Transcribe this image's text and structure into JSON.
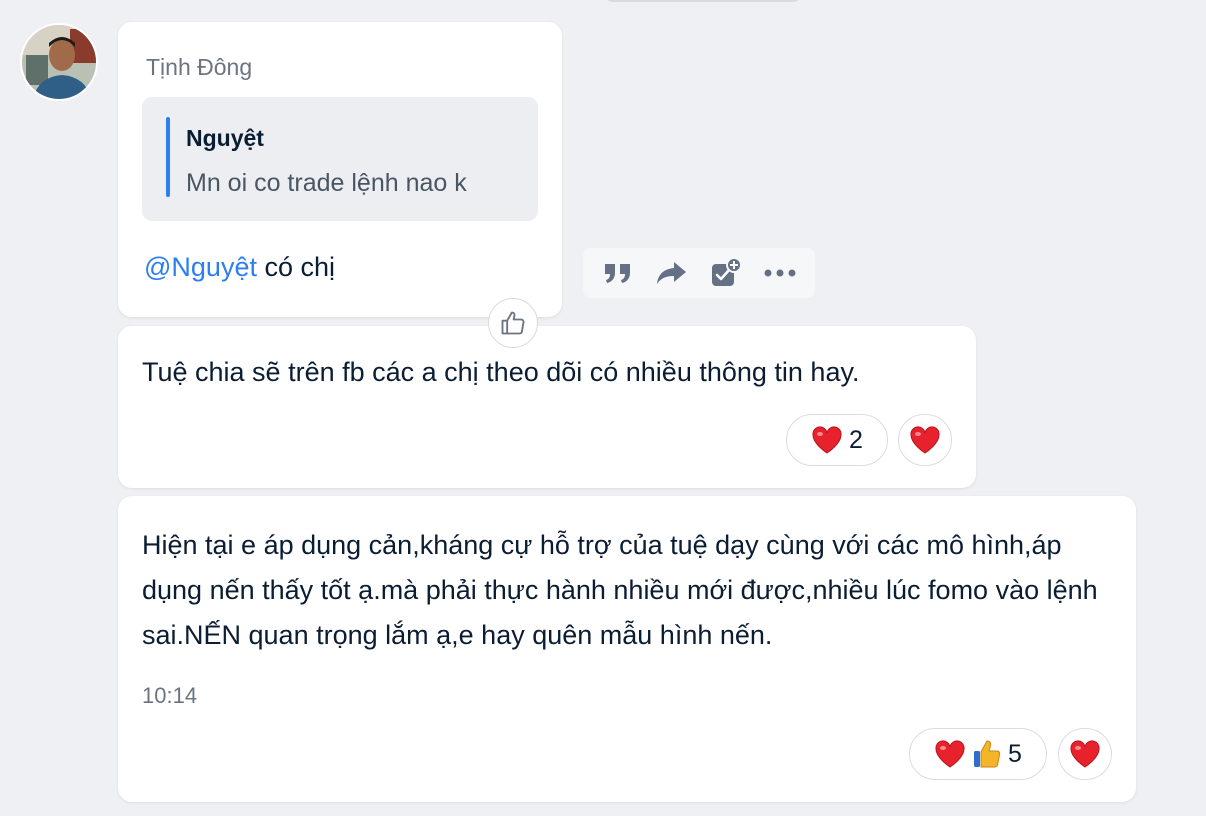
{
  "message1": {
    "sender": "Tịnh Đông",
    "quote": {
      "author": "Nguyệt",
      "text": "Mn oi co trade lệnh nao k"
    },
    "mention": "@Nguyệt",
    "text": " có chị"
  },
  "toolbar": {
    "icons": [
      "quote-icon",
      "forward-icon",
      "add-task-icon",
      "more-icon"
    ]
  },
  "message2": {
    "text": "Tuệ chia sẽ trên fb các a chị theo dõi có nhiều thông tin hay.",
    "reaction_count": "2"
  },
  "message3": {
    "text": "Hiện tại e áp dụng cản,kháng cự hỗ trợ của tuệ dạy cùng với các mô hình,áp dụng nến thấy tốt ạ.mà phải thực hành nhiều mới được,nhiều lúc fomo vào lệnh sai.NẾN quan trọng lắm ạ,e hay quên mẫu hình nến.",
    "time": "10:14",
    "reaction_count": "5"
  },
  "colors": {
    "accent": "#2d7ff0",
    "heart": "#e8222c",
    "background": "#eef0f3"
  }
}
